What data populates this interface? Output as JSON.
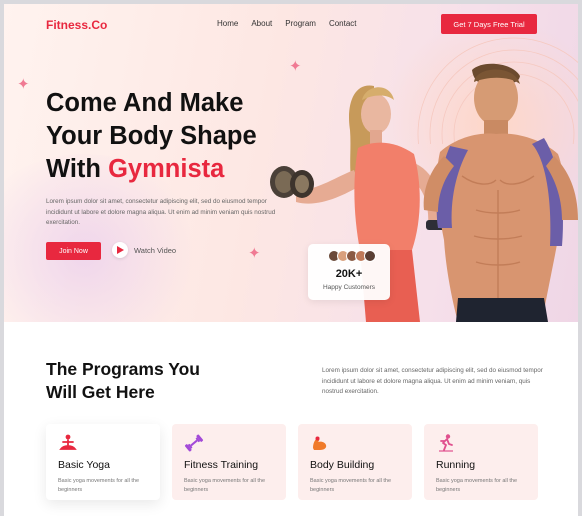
{
  "brand": {
    "logo": "Fitness.Co",
    "accent_color": "#e8283f"
  },
  "nav": {
    "items": [
      "Home",
      "About",
      "Program",
      "Contact"
    ]
  },
  "header": {
    "cta_label": "Get 7 Days Free Trial"
  },
  "hero": {
    "title_line1": "Come And Make",
    "title_line2": "Your Body Shape",
    "title_line3_prefix": "With ",
    "title_line3_accent": "Gymnista",
    "description": "Lorem ipsum dolor sit amet, consectetur adipiscing elit, sed do eiusmod tempor incididunt ut labore et dolore magna aliqua. Ut enim ad minim veniam quis nostrud exercitation.",
    "join_label": "Join Now",
    "watch_label": "Watch Video"
  },
  "stats": {
    "value": "20K+",
    "label": "Happy Customers"
  },
  "programs": {
    "title_line1": "The Programs You",
    "title_line2": "Will Get Here",
    "description": "Lorem ipsum dolor sit amet, consectetur adipiscing elit, sed do eiusmod tempor incididunt ut labore et dolore magna aliqua. Ut enim ad minim veniam, quis nostrud exercitation.",
    "cards": [
      {
        "title": "Basic Yoga",
        "desc": "Basic yoga movements for all the beginners",
        "icon": "yoga-icon",
        "active": true
      },
      {
        "title": "Fitness Training",
        "desc": "Basic yoga movements for all the beginners",
        "icon": "dumbbell-icon",
        "active": false
      },
      {
        "title": "Body Building",
        "desc": "Basic yoga movements for all the beginners",
        "icon": "muscle-icon",
        "active": false
      },
      {
        "title": "Running",
        "desc": "Basic yoga movements for all the beginners",
        "icon": "running-icon",
        "active": false
      }
    ]
  }
}
